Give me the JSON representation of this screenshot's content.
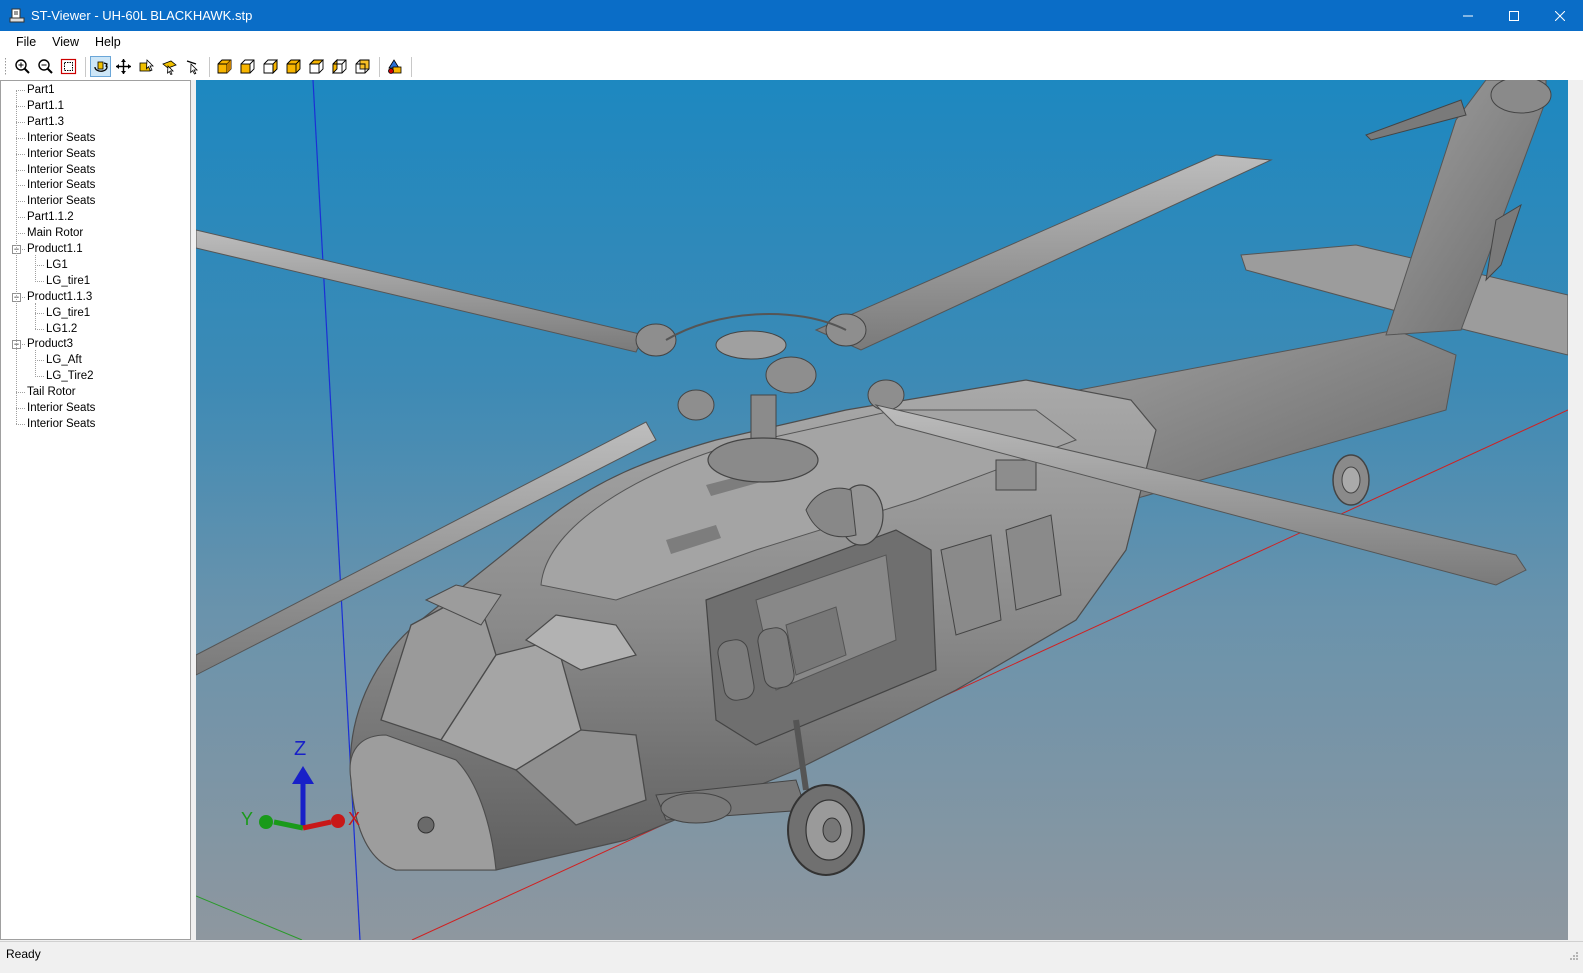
{
  "window": {
    "title": "ST-Viewer - UH-60L BLACKHAWK.stp"
  },
  "menu": {
    "items": [
      "File",
      "View",
      "Help"
    ]
  },
  "toolbar": {
    "buttons": [
      {
        "icon": "zoom-in-icon"
      },
      {
        "icon": "zoom-out-icon"
      },
      {
        "icon": "zoom-fit-icon"
      },
      {
        "icon": "rotate-icon",
        "active": true
      },
      {
        "icon": "pan-icon"
      },
      {
        "icon": "select-icon"
      },
      {
        "icon": "select-edge-icon"
      },
      {
        "icon": "pick-icon"
      },
      {
        "icon": "view-iso-icon"
      },
      {
        "icon": "view-front-icon"
      },
      {
        "icon": "view-back-icon"
      },
      {
        "icon": "view-top-icon"
      },
      {
        "icon": "view-bottom-icon"
      },
      {
        "icon": "view-left-icon"
      },
      {
        "icon": "view-right-icon"
      },
      {
        "icon": "shading-icon"
      }
    ]
  },
  "tree": {
    "items": [
      {
        "label": "Part1",
        "level": 0
      },
      {
        "label": "Part1.1",
        "level": 0
      },
      {
        "label": "Part1.3",
        "level": 0
      },
      {
        "label": "Interior Seats",
        "level": 0
      },
      {
        "label": "Interior Seats",
        "level": 0
      },
      {
        "label": "Interior Seats",
        "level": 0
      },
      {
        "label": "Interior Seats",
        "level": 0
      },
      {
        "label": "Interior Seats",
        "level": 0
      },
      {
        "label": "Part1.1.2",
        "level": 0
      },
      {
        "label": "Main Rotor",
        "level": 0
      },
      {
        "label": "Product1.1",
        "level": 0,
        "expanded": true
      },
      {
        "label": "LG1",
        "level": 1
      },
      {
        "label": "LG_tire1",
        "level": 1
      },
      {
        "label": "Product1.1.3",
        "level": 0,
        "expanded": true
      },
      {
        "label": "LG_tire1",
        "level": 1
      },
      {
        "label": "LG1.2",
        "level": 1
      },
      {
        "label": "Product3",
        "level": 0,
        "expanded": true
      },
      {
        "label": "LG_Aft",
        "level": 1
      },
      {
        "label": "LG_Tire2",
        "level": 1
      },
      {
        "label": "Tail Rotor",
        "level": 0
      },
      {
        "label": "Interior Seats",
        "level": 0
      },
      {
        "label": "Interior Seats",
        "level": 0
      }
    ]
  },
  "viewport": {
    "axes": {
      "x": "X",
      "y": "Y",
      "z": "Z"
    }
  },
  "status": {
    "text": "Ready"
  },
  "colors": {
    "titlebar": "#0a6dc7",
    "viewport_top": "#1d88c0",
    "viewport_bottom": "#8e979f",
    "model": "#8c8c8c"
  }
}
